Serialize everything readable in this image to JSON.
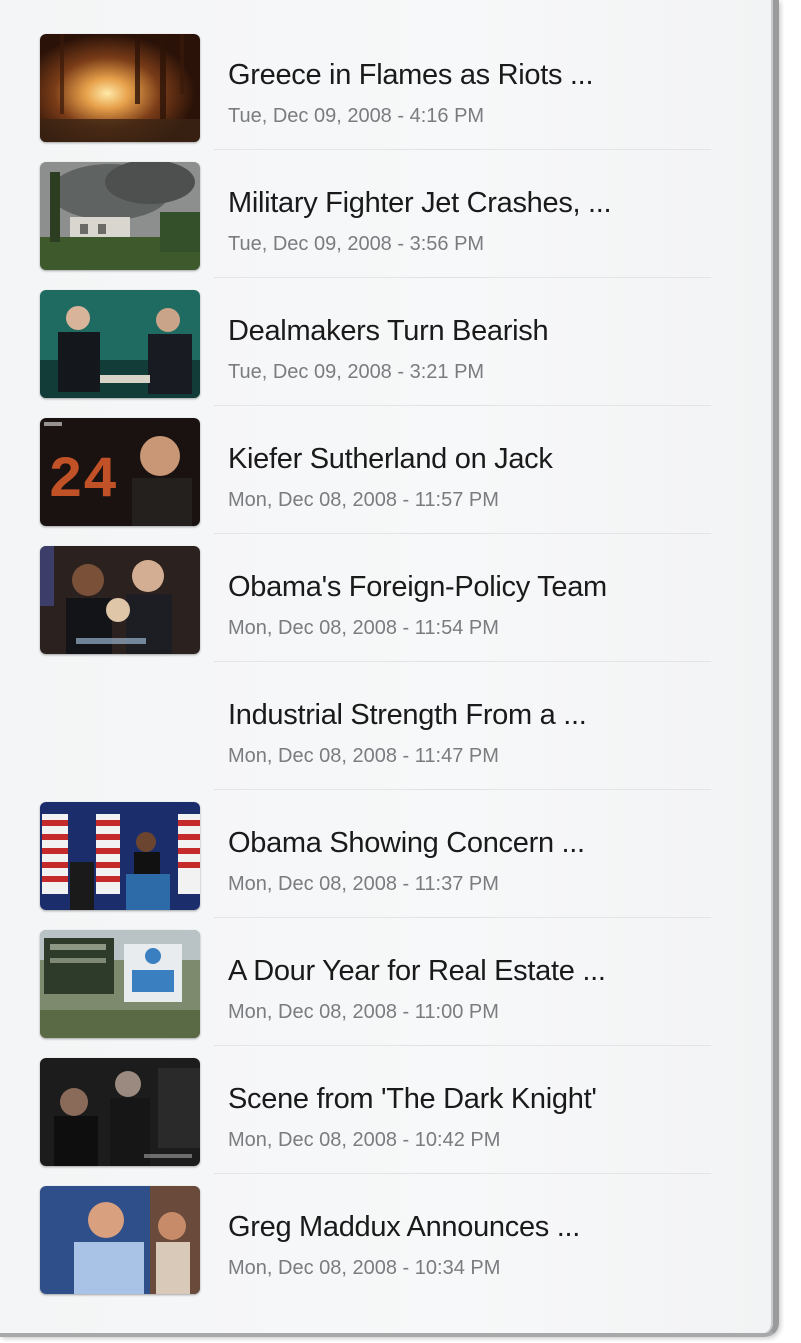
{
  "videos": [
    {
      "title": "Greece in Flames as Riots ...",
      "date": "Tue, Dec 09, 2008 - 4:16 PM",
      "thumbnail": "riot-fire-thumbnail"
    },
    {
      "title": "Military Fighter Jet Crashes, ...",
      "date": "Tue, Dec 09, 2008 - 3:56 PM",
      "thumbnail": "jet-crash-smoke-thumbnail"
    },
    {
      "title": "Dealmakers Turn Bearish",
      "date": "Tue, Dec 09, 2008 - 3:21 PM",
      "thumbnail": "interview-thumbnail"
    },
    {
      "title": "Kiefer Sutherland on Jack",
      "date": "Mon, Dec 08, 2008 - 11:57 PM",
      "thumbnail": "24-show-thumbnail",
      "thumbnail_text": "24"
    },
    {
      "title": "Obama's Foreign-Policy Team",
      "date": "Mon, Dec 08, 2008 - 11:54 PM",
      "thumbnail": "policy-team-thumbnail"
    },
    {
      "title": "Industrial Strength From a ...",
      "date": "Mon, Dec 08, 2008 - 11:47 PM",
      "thumbnail": null
    },
    {
      "title": "Obama Showing Concern ...",
      "date": "Mon, Dec 08, 2008 - 11:37 PM",
      "thumbnail": "podium-flags-thumbnail"
    },
    {
      "title": "A Dour Year for Real Estate ...",
      "date": "Mon, Dec 08, 2008 - 11:00 PM",
      "thumbnail": "real-estate-signs-thumbnail"
    },
    {
      "title": "Scene from 'The Dark Knight'",
      "date": "Mon, Dec 08, 2008 - 10:42 PM",
      "thumbnail": "dark-knight-scene-thumbnail"
    },
    {
      "title": "Greg Maddux Announces ...",
      "date": "Mon, Dec 08, 2008 - 10:34 PM",
      "thumbnail": "maddux-press-thumbnail"
    }
  ]
}
